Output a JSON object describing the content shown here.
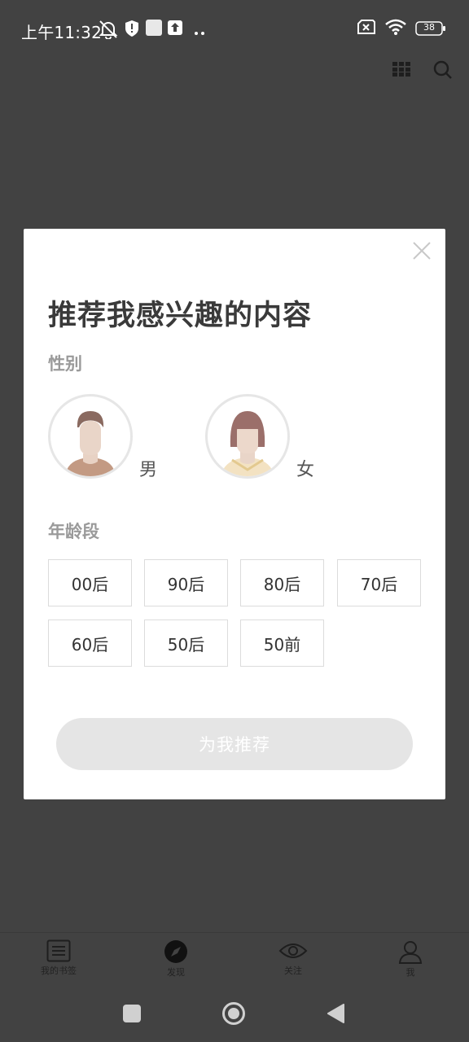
{
  "status_bar": {
    "time": "上午11:32",
    "battery": "38",
    "icons": [
      "mute-bell-icon",
      "shield-icon",
      "square-icon",
      "upload-icon",
      "more-dots-icon",
      "no-sim-icon",
      "wifi-icon",
      "battery-icon"
    ]
  },
  "toolbar": {
    "icons": [
      "grid-icon",
      "search-icon"
    ]
  },
  "modal": {
    "title": "推荐我感兴趣的内容",
    "gender_label": "性别",
    "genders": [
      {
        "label": "男",
        "icon": "male-avatar-icon"
      },
      {
        "label": "女",
        "icon": "female-avatar-icon"
      }
    ],
    "age_label": "年龄段",
    "ages": [
      "00后",
      "90后",
      "80后",
      "70后",
      "60后",
      "50后",
      "50前"
    ],
    "recommend_button": "为我推荐",
    "close_icon": "close-icon"
  },
  "bottom_nav": {
    "items": [
      {
        "label": "我的书签",
        "icon": "bookmark-list-icon"
      },
      {
        "label": "发现",
        "icon": "compass-icon"
      },
      {
        "label": "关注",
        "icon": "eye-icon"
      },
      {
        "label": "我",
        "icon": "person-icon"
      }
    ]
  },
  "system_nav": {
    "icons": [
      "recents-square-icon",
      "home-circle-icon",
      "back-triangle-icon"
    ]
  },
  "colors": {
    "overlay": "#424242",
    "modal_bg": "#ffffff",
    "button_disabled": "#e5e5e5"
  }
}
